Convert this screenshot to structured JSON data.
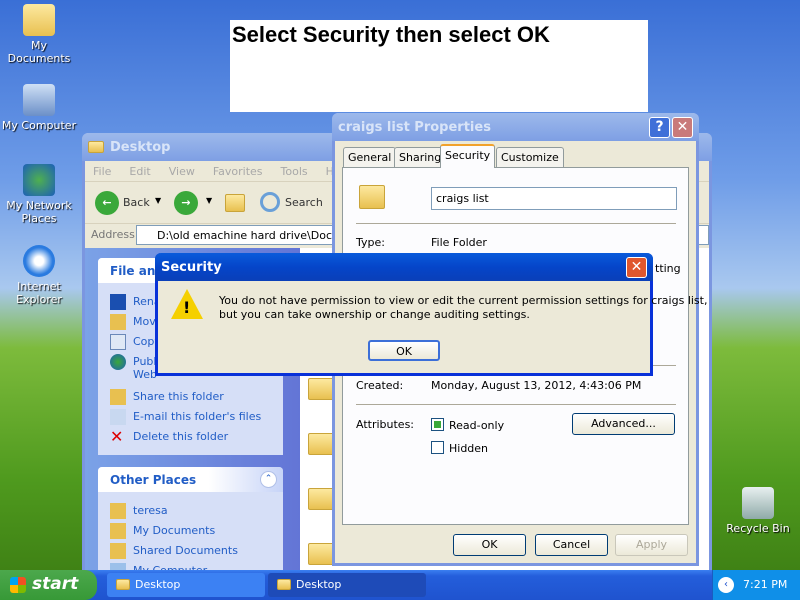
{
  "instruction": "Select Security then select OK",
  "desktop_icons": [
    "My Documents",
    "My Computer",
    "My Network Places",
    "Internet Explorer",
    "Recycle Bin"
  ],
  "explorer": {
    "title": "Desktop",
    "menu": [
      "File",
      "Edit",
      "View",
      "Favorites",
      "Tools",
      "Help"
    ],
    "back": "Back",
    "search": "Search",
    "address_label": "Address",
    "address": "D:\\old emachine hard drive\\Documen",
    "file_tasks": {
      "title": "File and",
      "items": [
        "Rena",
        "Move",
        "Copy",
        "Publi",
        "Web",
        "Share this folder",
        "E-mail this folder's files",
        "Delete this folder"
      ]
    },
    "other_places": {
      "title": "Other Places",
      "items": [
        "teresa",
        "My Documents",
        "Shared Documents",
        "My Computer"
      ]
    }
  },
  "properties": {
    "title": "craigs list Properties",
    "tabs": [
      "General",
      "Sharing",
      "Security",
      "Customize"
    ],
    "active_tab": "Security",
    "name": "craigs list",
    "type_label": "Type:",
    "type": "File Folder",
    "partial": "tting",
    "created_label": "Created:",
    "created": "Monday, August 13, 2012, 4:43:06 PM",
    "attributes_label": "Attributes:",
    "readonly": "Read-only",
    "hidden": "Hidden",
    "advanced": "Advanced...",
    "ok": "OK",
    "cancel": "Cancel",
    "apply": "Apply"
  },
  "security_dialog": {
    "title": "Security",
    "line1": "You do not have permission to view or edit the current permission settings for craigs list,",
    "line2": "but you can take ownership or change auditing settings.",
    "ok": "OK"
  },
  "taskbar": {
    "start": "start",
    "tasks": [
      "Desktop",
      "Desktop"
    ],
    "time": "7:21 PM"
  }
}
